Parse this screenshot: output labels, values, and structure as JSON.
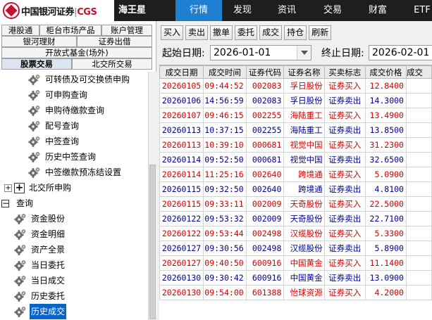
{
  "header": {
    "brand_cn": "中国银河证券",
    "brand_en": "CGS",
    "app_name": "海王星",
    "nav": [
      "行情",
      "发现",
      "资讯",
      "交易",
      "财富",
      "ETF"
    ],
    "active_nav": "行情"
  },
  "sidebar": {
    "tab_rows": [
      [
        "港股通",
        "柜台市场产品",
        "账户管理"
      ],
      [
        "银河理财",
        "证券出借"
      ],
      [
        "开放式基金(场外)"
      ],
      [
        "股票交易",
        "北交所交易"
      ]
    ],
    "selected_tab": "股票交易",
    "tree": [
      {
        "label": "可转债及可交换债申购",
        "kind": "leaf"
      },
      {
        "label": "可申购查询",
        "kind": "leaf"
      },
      {
        "label": "申购待缴款查询",
        "kind": "leaf"
      },
      {
        "label": "配号查询",
        "kind": "leaf"
      },
      {
        "label": "中签查询",
        "kind": "leaf"
      },
      {
        "label": "历史中签查询",
        "kind": "leaf"
      },
      {
        "label": "中签缴款预冻结设置",
        "kind": "leaf"
      },
      {
        "label": "北交所申购",
        "kind": "collapsed"
      },
      {
        "label": "查询",
        "kind": "expanded"
      },
      {
        "label": "资金股份",
        "kind": "leaf2"
      },
      {
        "label": "资金明细",
        "kind": "leaf2"
      },
      {
        "label": "资产全景",
        "kind": "leaf2"
      },
      {
        "label": "当日委托",
        "kind": "leaf2"
      },
      {
        "label": "当日成交",
        "kind": "leaf2"
      },
      {
        "label": "历史委托",
        "kind": "leaf2"
      },
      {
        "label": "历史成交",
        "kind": "leaf2",
        "selected": true
      }
    ]
  },
  "toolbar": {
    "buttons": [
      "买入",
      "卖出",
      "撤单",
      "委托",
      "成交",
      "持仓",
      "刷新"
    ]
  },
  "filters": {
    "start_label": "起始日期:",
    "start_value": "2026-01-01",
    "end_label": "终止日期:",
    "end_value": "2026-02-01"
  },
  "table": {
    "columns": [
      "成交日期",
      "成交时间",
      "证券代码",
      "证券名称",
      "买卖标志",
      "成交价格",
      "成交"
    ],
    "rows": [
      {
        "date": "20260105",
        "time": "09:44:52",
        "code": "002083",
        "name": "孚日股份",
        "side": "证券买入",
        "price": "12.8400"
      },
      {
        "date": "20260106",
        "time": "14:56:59",
        "code": "002083",
        "name": "孚日股份",
        "side": "证券卖出",
        "price": "14.3000"
      },
      {
        "date": "20260107",
        "time": "09:46:15",
        "code": "002255",
        "name": "海陆重工",
        "side": "证券买入",
        "price": "13.4900"
      },
      {
        "date": "20260113",
        "time": "10:37:15",
        "code": "002255",
        "name": "海陆重工",
        "side": "证券卖出",
        "price": "13.8500"
      },
      {
        "date": "20260113",
        "time": "10:39:10",
        "code": "000681",
        "name": "视觉中国",
        "side": "证券买入",
        "price": "31.2300"
      },
      {
        "date": "20260114",
        "time": "09:52:50",
        "code": "000681",
        "name": "视觉中国",
        "side": "证券卖出",
        "price": "32.6500"
      },
      {
        "date": "20260114",
        "time": "11:25:16",
        "code": "002640",
        "name": "跨境通",
        "side": "证券买入",
        "price": "5.0900"
      },
      {
        "date": "20260115",
        "time": "09:32:50",
        "code": "002640",
        "name": "跨境通",
        "side": "证券卖出",
        "price": "4.8100"
      },
      {
        "date": "20260115",
        "time": "09:33:11",
        "code": "002009",
        "name": "天奇股份",
        "side": "证券买入",
        "price": "22.5000"
      },
      {
        "date": "20260122",
        "time": "09:53:32",
        "code": "002009",
        "name": "天奇股份",
        "side": "证券卖出",
        "price": "22.7100"
      },
      {
        "date": "20260122",
        "time": "09:53:44",
        "code": "002498",
        "name": "汉缆股份",
        "side": "证券买入",
        "price": "5.3300"
      },
      {
        "date": "20260127",
        "time": "09:30:56",
        "code": "002498",
        "name": "汉缆股份",
        "side": "证券卖出",
        "price": "5.8900"
      },
      {
        "date": "20260127",
        "time": "09:40:50",
        "code": "600916",
        "name": "中国黄金",
        "side": "证券买入",
        "price": "11.1400"
      },
      {
        "date": "20260130",
        "time": "09:30:42",
        "code": "600916",
        "name": "中国黄金",
        "side": "证券卖出",
        "price": "13.0900"
      },
      {
        "date": "20260130",
        "time": "09:54:00",
        "code": "601388",
        "name": "怡球资源",
        "side": "证券买入",
        "price": "4.2000"
      }
    ]
  },
  "colors": {
    "buy": "#d10000",
    "sell": "#00008b",
    "accent": "#1f7fd0",
    "selected": "#0a64c8"
  }
}
